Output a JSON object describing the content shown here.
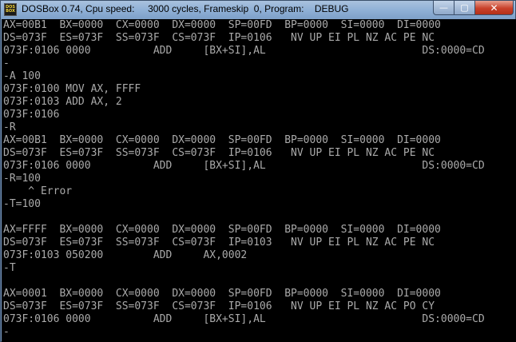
{
  "window": {
    "title": "DOSBox 0.74, Cpu speed:     3000 cycles, Frameskip  0, Program:    DEBUG",
    "icon_text_top": "DOS",
    "icon_text_bottom": "BOX",
    "minimize_glyph": "—",
    "maximize_glyph": "▢",
    "close_glyph": "✕"
  },
  "terminal": {
    "text_color": "#aaaaaa",
    "background": "#000000",
    "lines": [
      "AX=00B1  BX=0000  CX=0000  DX=0000  SP=00FD  BP=0000  SI=0000  DI=0000",
      "DS=073F  ES=073F  SS=073F  CS=073F  IP=0106   NV UP EI PL NZ AC PE NC",
      "073F:0106 0000          ADD     [BX+SI],AL                         DS:0000=CD",
      "-",
      "-A 100",
      "073F:0100 MOV AX, FFFF",
      "073F:0103 ADD AX, 2",
      "073F:0106",
      "-R",
      "AX=00B1  BX=0000  CX=0000  DX=0000  SP=00FD  BP=0000  SI=0000  DI=0000",
      "DS=073F  ES=073F  SS=073F  CS=073F  IP=0106   NV UP EI PL NZ AC PE NC",
      "073F:0106 0000          ADD     [BX+SI],AL                         DS:0000=CD",
      "-R=100",
      "    ^ Error",
      "-T=100",
      "",
      "AX=FFFF  BX=0000  CX=0000  DX=0000  SP=00FD  BP=0000  SI=0000  DI=0000",
      "DS=073F  ES=073F  SS=073F  CS=073F  IP=0103   NV UP EI PL NZ AC PE NC",
      "073F:0103 050200        ADD     AX,0002",
      "-T",
      "",
      "AX=0001  BX=0000  CX=0000  DX=0000  SP=00FD  BP=0000  SI=0000  DI=0000",
      "DS=073F  ES=073F  SS=073F  CS=073F  IP=0106   NV UP EI PL NZ AC PO CY",
      "073F:0106 0000          ADD     [BX+SI],AL                         DS:0000=CD",
      "-"
    ]
  }
}
